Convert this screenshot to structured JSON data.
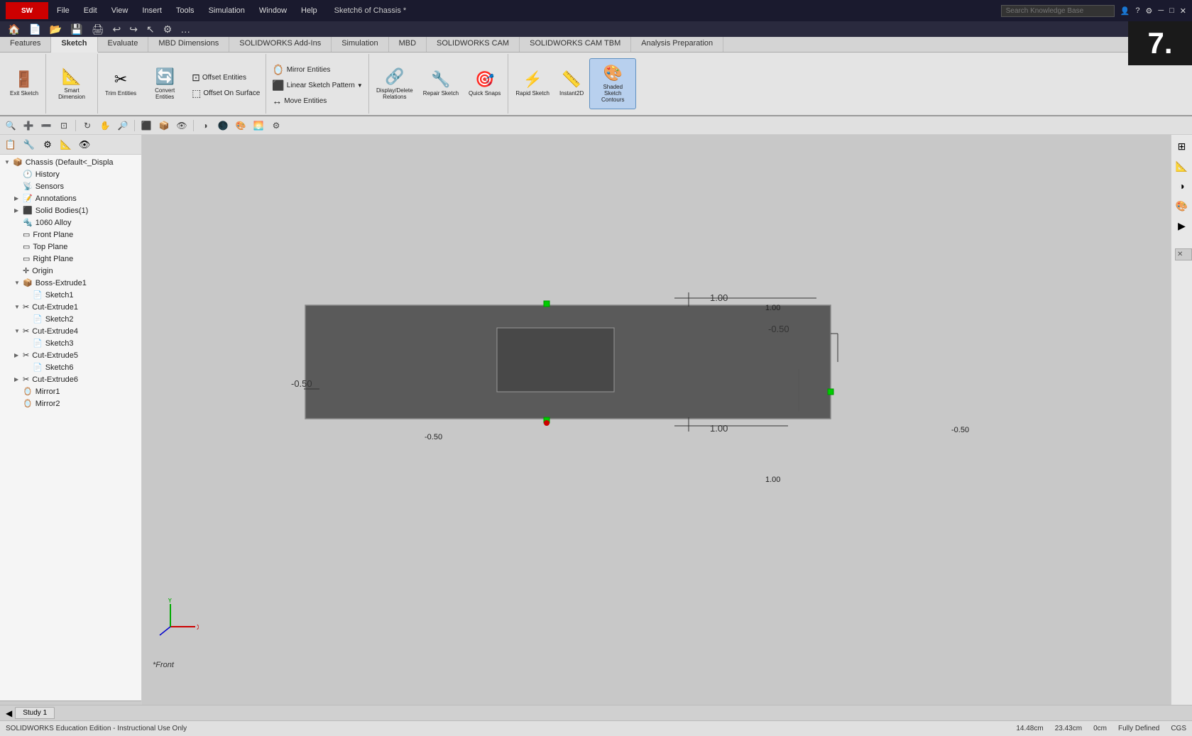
{
  "app": {
    "title": "Sketch6 of Chassis *",
    "logo": "SW",
    "edition": "SOLIDWORKS Education Edition - Instructional Use Only"
  },
  "titlebar": {
    "menu": [
      "File",
      "Edit",
      "View",
      "Insert",
      "Tools",
      "Simulation",
      "Window",
      "Help"
    ],
    "title": "Sketch6 of Chassis *",
    "search_placeholder": "Search Knowledge Base",
    "overlay_number": "7."
  },
  "ribbon": {
    "tabs": [
      "Features",
      "Sketch",
      "Evaluate",
      "MBD Dimensions",
      "SOLIDWORKS Add-Ins",
      "Simulation",
      "MBD",
      "SOLIDWORKS CAM",
      "SOLIDWORKS CAM TBM",
      "Analysis Preparation"
    ],
    "active_tab": "Sketch",
    "buttons": {
      "exit_sketch": "Exit Sketch",
      "smart_dimension": "Smart Dimension",
      "trim_entities": "Trim Entities",
      "convert_entities": "Convert Entities",
      "offset_entities": "Offset Entities",
      "offset_on_surface": "Offset On Surface",
      "mirror_entities": "Mirror Entities",
      "linear_sketch_pattern": "Linear Sketch Pattern",
      "move_entities": "Move Entities",
      "display_delete": "Display/Delete Relations",
      "repair_sketch": "Repair Sketch",
      "quick_snaps": "Quick Snaps",
      "rapid_sketch": "Rapid Sketch",
      "instant2d": "Instant2D",
      "shaded_sketch": "Shaded Sketch Contours"
    }
  },
  "view_toolbar": {
    "buttons": [
      "🔍",
      "🔎",
      "⊕",
      "⊗",
      "↔",
      "⇄",
      "🔲",
      "⬛",
      "🎯",
      "◉",
      "🌐",
      "⬜",
      "◻",
      "▪"
    ]
  },
  "panel_icons": [
    "☰",
    "🔧",
    "⊕",
    "◎",
    "▶",
    "»"
  ],
  "tree": [
    {
      "label": "Chassis (Default<<Default>_Displa",
      "level": 0,
      "icon": "📦",
      "expand": "▼"
    },
    {
      "label": "History",
      "level": 1,
      "icon": "🕐",
      "expand": " "
    },
    {
      "label": "Sensors",
      "level": 1,
      "icon": "📡",
      "expand": " "
    },
    {
      "label": "Annotations",
      "level": 1,
      "icon": "📝",
      "expand": "▶"
    },
    {
      "label": "Solid Bodies(1)",
      "level": 1,
      "icon": "⬛",
      "expand": "▶"
    },
    {
      "label": "1060 Alloy",
      "level": 1,
      "icon": "🔩",
      "expand": " "
    },
    {
      "label": "Front Plane",
      "level": 1,
      "icon": "▭",
      "expand": " "
    },
    {
      "label": "Top Plane",
      "level": 1,
      "icon": "▭",
      "expand": " "
    },
    {
      "label": "Right Plane",
      "level": 1,
      "icon": "▭",
      "expand": " "
    },
    {
      "label": "Origin",
      "level": 1,
      "icon": "✛",
      "expand": " "
    },
    {
      "label": "Boss-Extrude1",
      "level": 1,
      "icon": "📦",
      "expand": "▼"
    },
    {
      "label": "Sketch1",
      "level": 2,
      "icon": "📄",
      "expand": " "
    },
    {
      "label": "Cut-Extrude1",
      "level": 1,
      "icon": "✂",
      "expand": "▼"
    },
    {
      "label": "Sketch2",
      "level": 2,
      "icon": "📄",
      "expand": " "
    },
    {
      "label": "Cut-Extrude4",
      "level": 1,
      "icon": "✂",
      "expand": "▼"
    },
    {
      "label": "Sketch3",
      "level": 2,
      "icon": "📄",
      "expand": " "
    },
    {
      "label": "Cut-Extrude5",
      "level": 1,
      "icon": "✂",
      "expand": "▶"
    },
    {
      "label": "Sketch6",
      "level": 2,
      "icon": "📄",
      "expand": " "
    },
    {
      "label": "Cut-Extrude6",
      "level": 1,
      "icon": "✂",
      "expand": "▶"
    },
    {
      "label": "Mirror1",
      "level": 1,
      "icon": "🪞",
      "expand": " "
    },
    {
      "label": "Mirror2",
      "level": 1,
      "icon": "🪞",
      "expand": " "
    }
  ],
  "canvas": {
    "view_label": "*Front",
    "sketch_bg": "#5a5a5a",
    "dimensions": {
      "top_right": "1.00",
      "bottom_right": "1.00",
      "left": "-0.50",
      "right_edge": "-0.50"
    }
  },
  "status_bar": {
    "left": "SOLIDWORKS Education Edition - Instructional Use Only",
    "coords": "14.48cm",
    "coords2": "23.43cm",
    "coords3": "0cm",
    "status": "Fully Defined",
    "units": "CGS"
  },
  "bottom_tabs": [
    {
      "label": "Study 1",
      "active": true
    }
  ],
  "right_panel_buttons": [
    "⊞",
    "⊟",
    "▣",
    "⬒",
    "◑",
    "▷"
  ]
}
